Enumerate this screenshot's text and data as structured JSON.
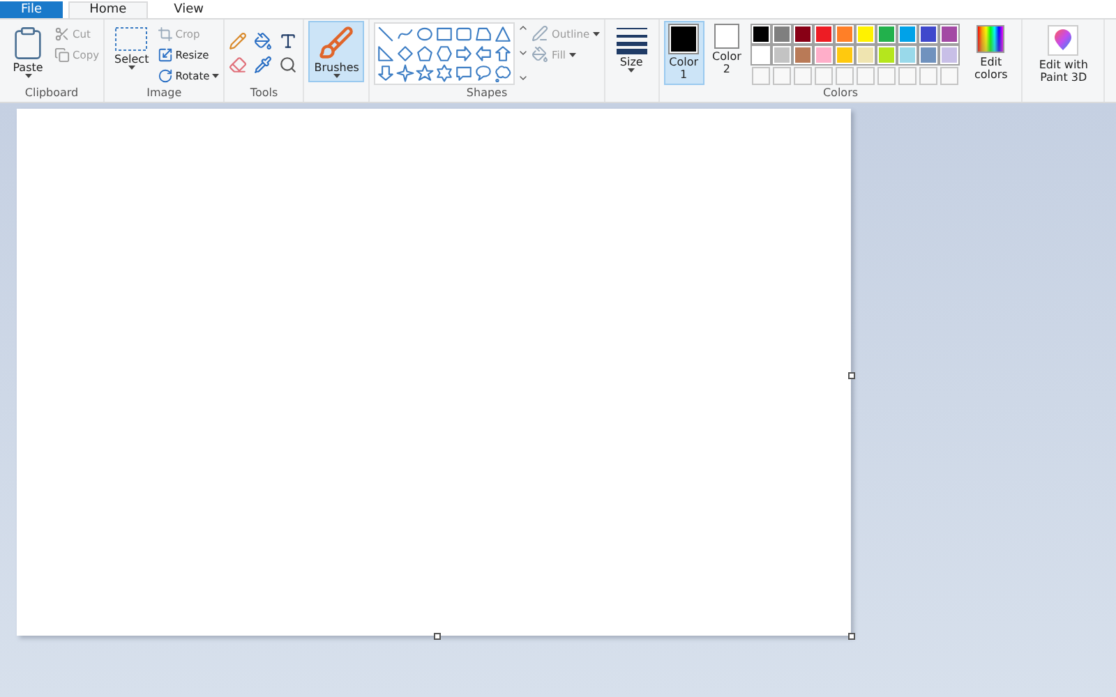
{
  "tabs": [
    {
      "label": "File",
      "selected": false,
      "kind": "file"
    },
    {
      "label": "Home",
      "selected": true,
      "kind": "tab"
    },
    {
      "label": "View",
      "selected": false,
      "kind": "tab"
    }
  ],
  "clipboard": {
    "label": "Clipboard",
    "paste": "Paste",
    "cut": {
      "label": "Cut",
      "disabled": true
    },
    "copy": {
      "label": "Copy",
      "disabled": true
    }
  },
  "image": {
    "label": "Image",
    "select": "Select",
    "crop": {
      "label": "Crop",
      "disabled": true
    },
    "resize": {
      "label": "Resize",
      "disabled": false
    },
    "rotate": {
      "label": "Rotate",
      "disabled": false
    }
  },
  "tools": {
    "label": "Tools"
  },
  "brushes": {
    "label": "Brushes",
    "selected": true
  },
  "shapes": {
    "label": "Shapes",
    "items": [
      {
        "kind": "line"
      },
      {
        "kind": "curve"
      },
      {
        "kind": "oval"
      },
      {
        "kind": "rectangle"
      },
      {
        "kind": "rounded-rectangle"
      },
      {
        "kind": "polygon"
      },
      {
        "kind": "triangle"
      },
      {
        "kind": "right-triangle"
      },
      {
        "kind": "diamond"
      },
      {
        "kind": "pentagon"
      },
      {
        "kind": "hexagon"
      },
      {
        "kind": "right-arrow"
      },
      {
        "kind": "left-arrow"
      },
      {
        "kind": "up-arrow"
      },
      {
        "kind": "down-arrow"
      },
      {
        "kind": "four-point-star"
      },
      {
        "kind": "five-point-star"
      },
      {
        "kind": "six-point-star"
      },
      {
        "kind": "rect-callout"
      },
      {
        "kind": "oval-callout"
      },
      {
        "kind": "cloud-callout"
      }
    ],
    "outline": {
      "label": "Outline",
      "disabled": true
    },
    "fill": {
      "label": "Fill",
      "disabled": true
    }
  },
  "size": {
    "label": "Size"
  },
  "colors": {
    "label": "Colors",
    "color1": {
      "label": "Color",
      "number": "1",
      "selected": true,
      "color": "#000000"
    },
    "color2": {
      "label": "Color",
      "number": "2",
      "selected": false,
      "color": "#ffffff"
    },
    "palette": [
      {
        "color": "#000000"
      },
      {
        "color": "#7f7f7f"
      },
      {
        "color": "#880015"
      },
      {
        "color": "#ed1c24"
      },
      {
        "color": "#ff7f27"
      },
      {
        "color": "#fff200"
      },
      {
        "color": "#22b14c"
      },
      {
        "color": "#00a2e8"
      },
      {
        "color": "#3f48cc"
      },
      {
        "color": "#a349a4"
      },
      {
        "color": "#ffffff"
      },
      {
        "color": "#c3c3c3"
      },
      {
        "color": "#b97a57"
      },
      {
        "color": "#ffaec9"
      },
      {
        "color": "#ffc90e"
      },
      {
        "color": "#efe4b0"
      },
      {
        "color": "#b5e61d"
      },
      {
        "color": "#99d9ea"
      },
      {
        "color": "#7092be"
      },
      {
        "color": "#c8bfe7"
      }
    ],
    "edit_colors": "Edit colors"
  },
  "paint3d": {
    "label": "Edit with Paint 3D"
  }
}
